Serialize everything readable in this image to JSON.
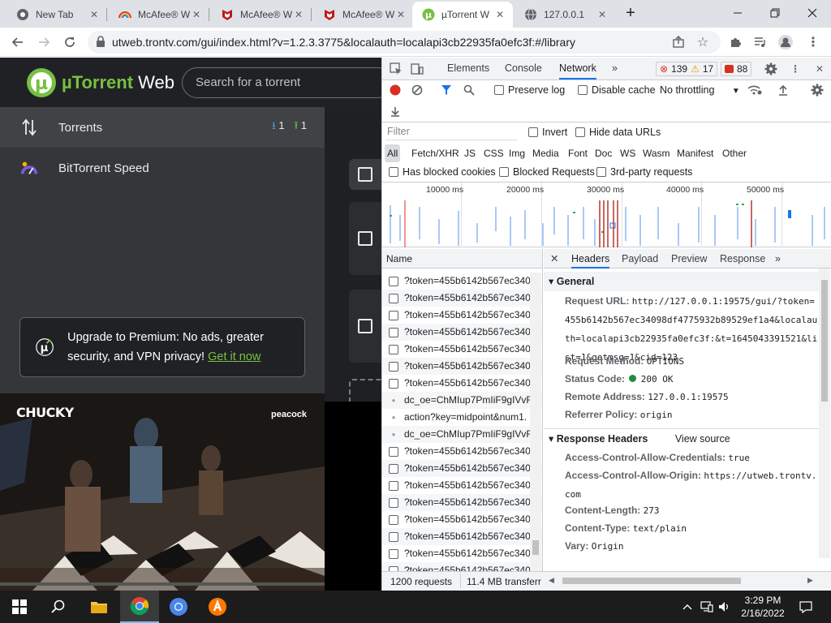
{
  "browser": {
    "tabs": [
      {
        "title": "New Tab",
        "icon": "chrome-icon"
      },
      {
        "title": "McAfee® W",
        "icon": "mcafee-rainbow-icon"
      },
      {
        "title": "McAfee® W",
        "icon": "mcafee-icon"
      },
      {
        "title": "McAfee® W",
        "icon": "mcafee-icon"
      },
      {
        "title": "µTorrent W",
        "icon": "utorrent-icon",
        "active": true
      },
      {
        "title": "127.0.0.1",
        "icon": "globe-icon"
      }
    ],
    "url": "utweb.trontv.com/gui/index.html?v=1.2.3.3775&localauth=localapi3cb22935fa0efc3f:#/library"
  },
  "utorrent": {
    "brand_mu": "µTorrent",
    "brand_web": "Web",
    "search_placeholder": "Search for a torrent",
    "nav": [
      {
        "label": "Torrents",
        "icon": "transfer-arrows-icon"
      },
      {
        "label": "BitTorrent Speed",
        "icon": "speed-gauge-icon"
      }
    ],
    "download_count": "1",
    "upload_count": "1",
    "premium_text": "Upgrade to Premium: No ads, greater security, and VPN privacy!",
    "premium_link": "Get it now",
    "video_title": "CHUCKY",
    "video_network": "peacock",
    "colors": {
      "accent": "#76c043",
      "panel": "#353639",
      "header": "#202124"
    }
  },
  "devtools": {
    "tabs": [
      "Elements",
      "Console",
      "Network"
    ],
    "active_tab": "Network",
    "more_tabs": "»",
    "errors": "139",
    "warnings": "17",
    "issues": "88",
    "toolbar": {
      "preserve_log": "Preserve log",
      "disable_cache": "Disable cache",
      "throttling": "No throttling"
    },
    "filter": {
      "placeholder": "Filter",
      "invert": "Invert",
      "hide_data_urls": "Hide data URLs",
      "types": [
        "All",
        "Fetch/XHR",
        "JS",
        "CSS",
        "Img",
        "Media",
        "Font",
        "Doc",
        "WS",
        "Wasm",
        "Manifest",
        "Other"
      ],
      "has_blocked_cookies": "Has blocked cookies",
      "blocked_requests": "Blocked Requests",
      "third_party": "3rd-party requests"
    },
    "timeline_ticks": [
      "10000 ms",
      "20000 ms",
      "30000 ms",
      "40000 ms",
      "50000 ms"
    ],
    "request_list": {
      "header": "Name",
      "rows": [
        {
          "name": "?token=455b6142b567ec340",
          "kind": "cb"
        },
        {
          "name": "?token=455b6142b567ec340",
          "kind": "cb"
        },
        {
          "name": "?token=455b6142b567ec340",
          "kind": "cb"
        },
        {
          "name": "?token=455b6142b567ec340",
          "kind": "cb"
        },
        {
          "name": "?token=455b6142b567ec340",
          "kind": "cb"
        },
        {
          "name": "?token=455b6142b567ec340",
          "kind": "cb"
        },
        {
          "name": "?token=455b6142b567ec340",
          "kind": "cb"
        },
        {
          "name": "dc_oe=ChMIup7PmIiF9gIVvR",
          "kind": "dot"
        },
        {
          "name": "action?key=midpoint&num1.",
          "kind": "dot"
        },
        {
          "name": "dc_oe=ChMIup7PmIiF9gIVvR",
          "kind": "dot"
        },
        {
          "name": "?token=455b6142b567ec340",
          "kind": "cb"
        },
        {
          "name": "?token=455b6142b567ec340",
          "kind": "cb"
        },
        {
          "name": "?token=455b6142b567ec340",
          "kind": "cb"
        },
        {
          "name": "?token=455b6142b567ec340",
          "kind": "cb"
        },
        {
          "name": "?token=455b6142b567ec340",
          "kind": "cb"
        },
        {
          "name": "?token=455b6142b567ec340",
          "kind": "cb"
        },
        {
          "name": "?token=455b6142b567ec340",
          "kind": "cb"
        },
        {
          "name": "?token=455b6142b567ec340",
          "kind": "cb"
        }
      ]
    },
    "detail_tabs": [
      "Headers",
      "Payload",
      "Preview",
      "Response"
    ],
    "active_detail_tab": "Headers",
    "general": {
      "title": "General",
      "request_url_label": "Request URL:",
      "request_url": "http://127.0.0.1:19575/gui/?token=455b6142b567ec34098df4775932b89529ef1a4&localauth=localapi3cb22935fa0efc3f:&t=1645043391521&list=1&getmsg=1&cid=123",
      "request_method_label": "Request Method:",
      "request_method": "OPTIONS",
      "status_code_label": "Status Code:",
      "status_code": "200 OK",
      "remote_address_label": "Remote Address:",
      "remote_address": "127.0.0.1:19575",
      "referrer_policy_label": "Referrer Policy:",
      "referrer_policy": "origin"
    },
    "response_headers": {
      "title": "Response Headers",
      "view_source": "View source",
      "acac_label": "Access-Control-Allow-Credentials:",
      "acac": "true",
      "acao_label": "Access-Control-Allow-Origin:",
      "acao": "https://utweb.trontv.com",
      "content_length_label": "Content-Length:",
      "content_length": "273",
      "content_type_label": "Content-Type:",
      "content_type": "text/plain",
      "vary_label": "Vary:",
      "vary": "Origin"
    },
    "status": {
      "requests": "1200 requests",
      "transferred": "11.4 MB transferr"
    }
  },
  "taskbar": {
    "time": "3:29 PM",
    "date": "2/16/2022"
  }
}
